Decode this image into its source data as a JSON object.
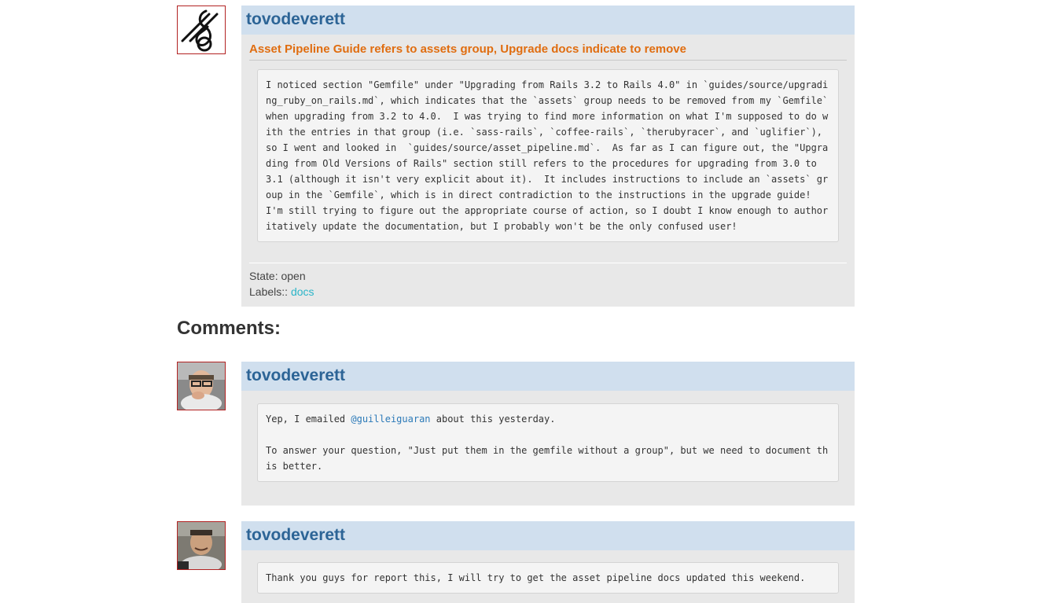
{
  "issue": {
    "author": "tovodeverett",
    "title": "Asset Pipeline Guide refers to assets group, Upgrade docs indicate to remove",
    "body": "I noticed section \"Gemfile\" under \"Upgrading from Rails 3.2 to Rails 4.0\" in `guides/source/upgrading_ruby_on_rails.md`, which indicates that the `assets` group needs to be removed from my `Gemfile` when upgrading from 3.2 to 4.0.  I was trying to find more information on what I'm supposed to do with the entries in that group (i.e. `sass-rails`, `coffee-rails`, `therubyracer`, and `uglifier`), so I went and looked in  `guides/source/asset_pipeline.md`.  As far as I can figure out, the \"Upgrading from Old Versions of Rails\" section still refers to the procedures for upgrading from 3.0 to 3.1 (although it isn't very explicit about it).  It includes instructions to include an `assets` group in the `Gemfile`, which is in direct contradiction to the instructions in the upgrade guide!  I'm still trying to figure out the appropriate course of action, so I doubt I know enough to authoritatively update the documentation, but I probably won't be the only confused user!",
    "state_label": "State:",
    "state_value": "open",
    "labels_label": "Labels::",
    "label_value": "docs"
  },
  "comments_heading": "Comments:",
  "comments": [
    {
      "author": "tovodeverett",
      "line1_pre": "Yep, I emailed ",
      "mention": "@guilleiguaran",
      "line1_post": " about this yesterday.",
      "paragraph2": "To answer your question, \"Just put them in the gemfile without a group\", but we need to document this better."
    },
    {
      "author": "tovodeverett",
      "body": "Thank you guys for report this, I will try to get the asset pipeline docs updated this weekend."
    }
  ],
  "colors": {
    "header_bg": "#d0dfee",
    "author": "#2c6496",
    "title": "#e06d10",
    "label_link": "#2bb5c8",
    "mention_link": "#2c7ab8",
    "avatar_border": "#b22222"
  }
}
